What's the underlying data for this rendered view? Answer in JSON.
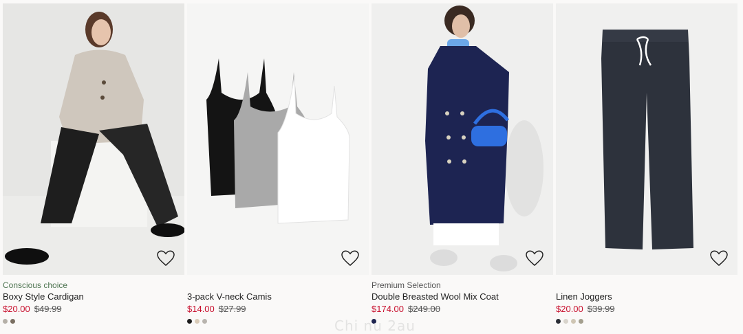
{
  "products": [
    {
      "marker": "Conscious choice",
      "title": "Boxy Style Cardigan",
      "sale_price": "$20.00",
      "original_price": "$49.99",
      "image": "model-wearing-beige-cardigan-and-leather-pants",
      "swatches": [
        "#b5b0a8",
        "#7a6f62"
      ]
    },
    {
      "marker": "",
      "title": "3-pack V-neck Camis",
      "sale_price": "$14.00",
      "original_price": "$27.99",
      "image": "black-grey-white-camisoles",
      "swatches": [
        "#1c1c1c",
        "#d9cbb8",
        "#b8b4ae"
      ]
    },
    {
      "marker": "Premium Selection",
      "title": "Double Breasted Wool Mix Coat",
      "sale_price": "$174.00",
      "original_price": "$249.00",
      "image": "model-wearing-navy-wool-coat",
      "swatches": [
        "#1f2550"
      ]
    },
    {
      "marker": "",
      "title": "Linen Joggers",
      "sale_price": "$20.00",
      "original_price": "$39.99",
      "image": "dark-navy-linen-joggers",
      "swatches": [
        "#2a2e36",
        "#d8d4cc",
        "#cfc6b4",
        "#a39f8e"
      ]
    }
  ],
  "favorite_icon": "heart-icon",
  "colors": {
    "sale": "#c8102e",
    "marker_green": "#4f7552"
  },
  "watermark": "Chi nu 2au"
}
